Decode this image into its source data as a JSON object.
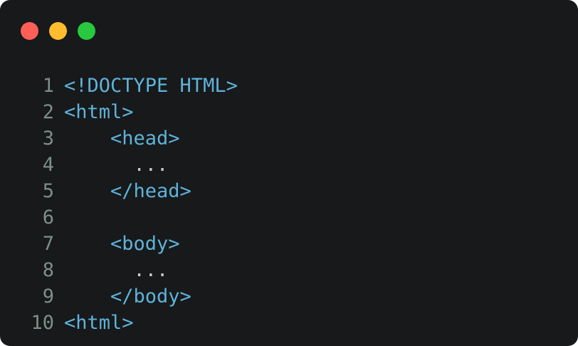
{
  "window": {
    "controls": [
      {
        "name": "close",
        "color": "#ff5f57"
      },
      {
        "name": "minimize",
        "color": "#febc2e"
      },
      {
        "name": "maximize",
        "color": "#28c840"
      }
    ]
  },
  "theme": {
    "background": "#17191b",
    "line_number_color": "#7d8f86",
    "tag_color": "#5fb3d9",
    "text_color": "#c8ccc9"
  },
  "code": {
    "lines": [
      {
        "number": "1",
        "text": "<!DOCTYPE HTML>",
        "kind": "tag"
      },
      {
        "number": "2",
        "text": "<html>",
        "kind": "tag"
      },
      {
        "number": "3",
        "text": "    <head>",
        "kind": "tag"
      },
      {
        "number": "4",
        "text": "      ...",
        "kind": "plain"
      },
      {
        "number": "5",
        "text": "    </head>",
        "kind": "tag"
      },
      {
        "number": "6",
        "text": "",
        "kind": "plain"
      },
      {
        "number": "7",
        "text": "    <body>",
        "kind": "tag"
      },
      {
        "number": "8",
        "text": "      ...",
        "kind": "plain"
      },
      {
        "number": "9",
        "text": "    </body>",
        "kind": "tag"
      },
      {
        "number": "10",
        "text": "<html>",
        "kind": "tag"
      }
    ]
  }
}
